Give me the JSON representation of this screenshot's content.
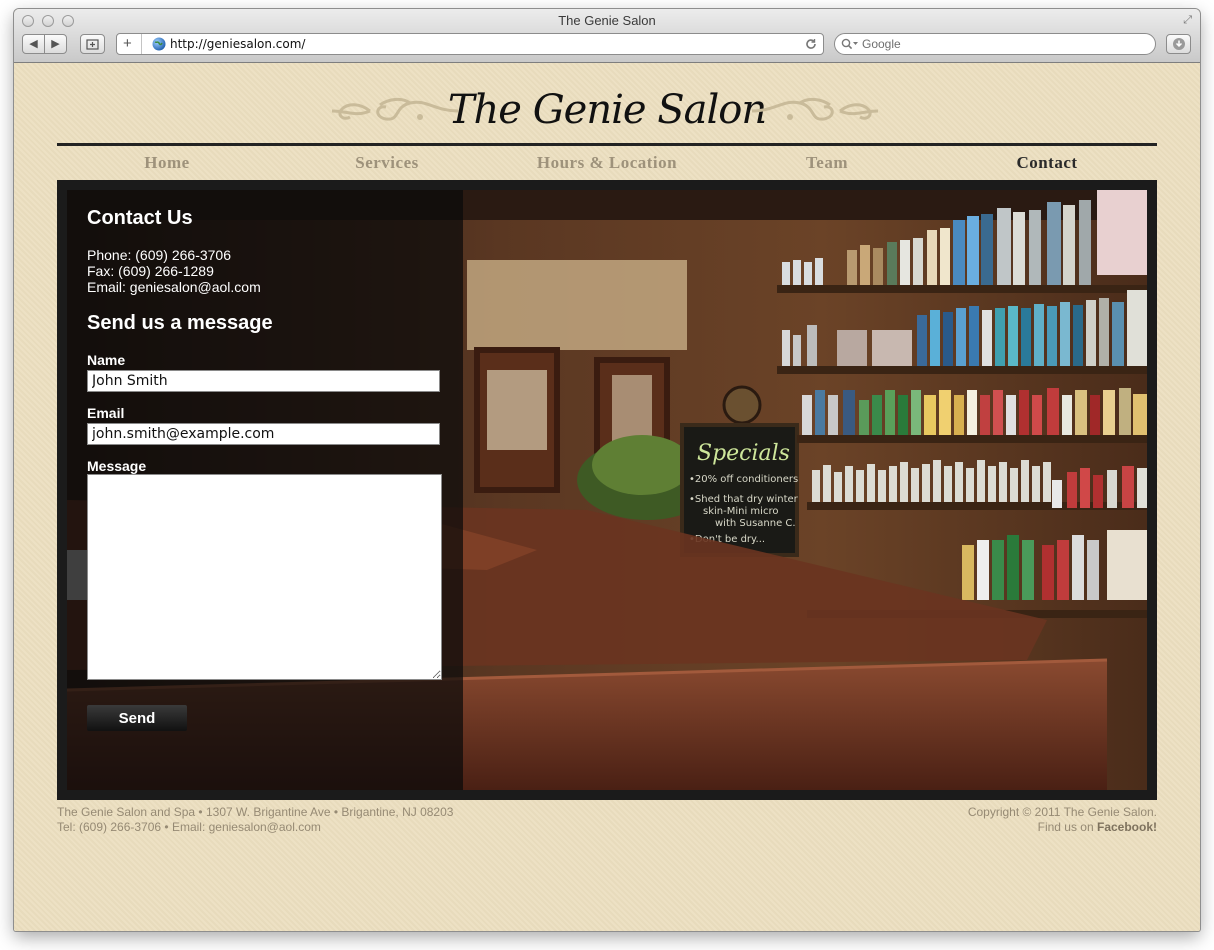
{
  "browser": {
    "window_title": "The Genie Salon",
    "url": "http://geniesalon.com/",
    "search_placeholder": "Google",
    "back_label": "◀",
    "forward_label": "▶",
    "add_label": "+"
  },
  "site": {
    "title": "The Genie Salon",
    "nav": [
      "Home",
      "Services",
      "Hours & Location",
      "Team",
      "Contact"
    ],
    "active_nav": "Contact"
  },
  "contact": {
    "heading": "Contact Us",
    "phone": "Phone: (609) 266-3706",
    "fax": "Fax: (609) 266-1289",
    "email": "Email: geniesalon@aol.com",
    "form_heading": "Send us a message",
    "name_label": "Name",
    "name_value": "John Smith",
    "email_label": "Email",
    "email_value": "john.smith@example.com",
    "message_label": "Message",
    "message_value": "",
    "send_label": "Send"
  },
  "photo": {
    "chalkboard_title": "Specials",
    "chalkboard_lines": [
      "•20% off conditioners",
      "•Shed that dry winter",
      "skin-Mini micro",
      "with Susanne C.",
      "•Don't be dry..."
    ]
  },
  "footer": {
    "address": "The Genie Salon and Spa • 1307 W. Brigantine Ave • Brigantine, NJ 08203",
    "contact": "Tel: (609) 266-3706 • Email: geniesalon@aol.com",
    "copyright": "Copyright © 2011 The Genie Salon.",
    "facebook_prefix": "Find us on ",
    "facebook_link": "Facebook!"
  },
  "colors": {
    "page_bg": "#ecdfc0",
    "nav_text": "#9e927b",
    "nav_active": "#2a2a2a"
  }
}
